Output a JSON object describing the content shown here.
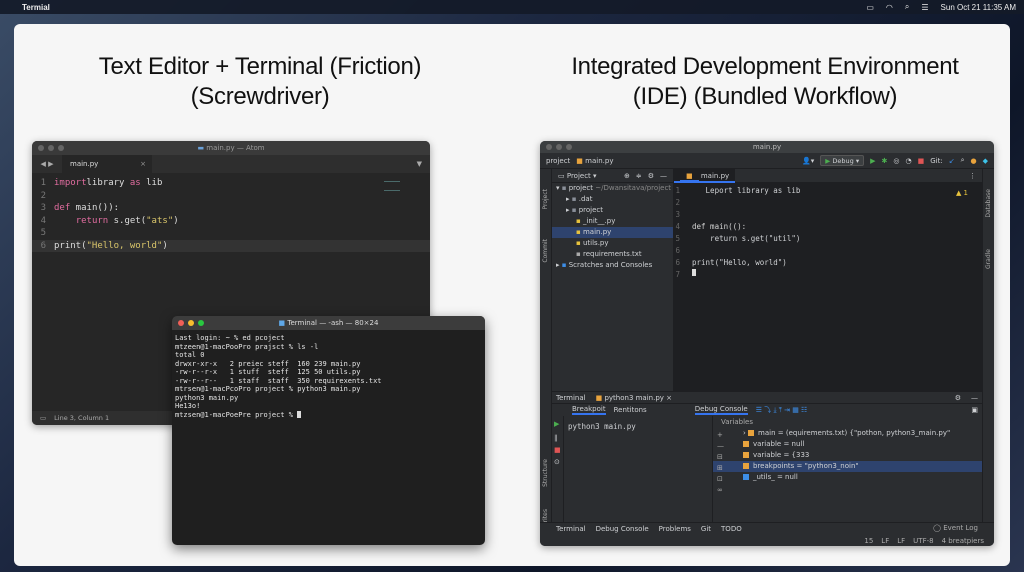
{
  "menubar": {
    "app_name": "Termial",
    "datetime": "Sun Oct 21 11:35 AM"
  },
  "left": {
    "heading_line1": "Text Editor + Terminal (Friction)",
    "heading_line2": "(Screwdriver)",
    "editor": {
      "window_title": "main.py — Atom",
      "tab": "main.py",
      "lines": [
        {
          "n": "1",
          "parts": [
            [
              "kw",
              "import"
            ],
            [
              "",
              "library "
            ],
            [
              "kw",
              "as"
            ],
            [
              "",
              " lib"
            ]
          ]
        },
        {
          "n": "2",
          "parts": []
        },
        {
          "n": "3",
          "parts": [
            [
              "kw",
              "def"
            ],
            [
              "",
              " main()):"
            ]
          ]
        },
        {
          "n": "4",
          "parts": [
            [
              "",
              "    "
            ],
            [
              "kw",
              "return"
            ],
            [
              "",
              " s.get("
            ],
            [
              "str",
              "\"ats\""
            ],
            [
              "",
              ")"
            ]
          ]
        },
        {
          "n": "5",
          "parts": []
        },
        {
          "n": "6",
          "parts": [
            [
              "",
              "print("
            ],
            [
              "str",
              "\"Hello, world\""
            ],
            [
              "",
              ")"
            ]
          ],
          "current": true
        }
      ],
      "status": "Line 3, Column 1"
    },
    "terminal": {
      "window_title": "Terminal — -ash — 80×24",
      "lines": [
        "Last login: ~ % ed pcoject",
        "mtzeen@1-macPooPro prajsct % ls -l",
        "total 0",
        "drwxr-xr-x   2 preiec steff  160 239 main.py",
        "-rw-r--r-x   1 stuff  steff  125 50 utils.py",
        "-rw-r--r--   1 staff  staff  350 requirexents.txt",
        "mtrsen@1-macPcoPro project % python3 main.py",
        "python3 main.py",
        "He13o!",
        "mtzsen@1-macPoePre project % "
      ]
    }
  },
  "right": {
    "heading_line1": "Integrated Development Environment",
    "heading_line2_bold": "(IDE)",
    "heading_line2_light": " (Bundled Workflow)",
    "ide": {
      "window_title": "main.py",
      "toolbar_project": "project",
      "toolbar_file": "main.py",
      "run_config": "Debug",
      "git_label": "Git:",
      "project_header": "Project",
      "tree": [
        {
          "label": "project",
          "extra": " ~/Dwansitava/project",
          "indent": 0,
          "icon": "folder"
        },
        {
          "label": ".dat",
          "indent": 1,
          "icon": "folder"
        },
        {
          "label": "project",
          "indent": 1,
          "icon": "folder"
        },
        {
          "label": "_init__.py",
          "indent": 2,
          "icon": "py"
        },
        {
          "label": "main.py",
          "indent": 2,
          "icon": "py",
          "selected": true
        },
        {
          "label": "utils.py",
          "indent": 2,
          "icon": "py"
        },
        {
          "label": "requirements.txt",
          "indent": 2,
          "icon": "txt"
        },
        {
          "label": "Scratches and Consoles",
          "indent": 0,
          "icon": "scratch"
        }
      ],
      "editor_tab": "main.py",
      "code": [
        {
          "n": "1",
          "text": "   Leport library as lib",
          "kwlen": 0
        },
        {
          "n": "2",
          "text": ""
        },
        {
          "n": "3",
          "text": ""
        },
        {
          "n": "4",
          "text": "def main(():"
        },
        {
          "n": "5",
          "text": "    return s.get(\"util\")"
        },
        {
          "n": "6",
          "text": ""
        },
        {
          "n": "6",
          "text": "print(\"Hello, world\")"
        },
        {
          "n": "7",
          "text": ""
        }
      ],
      "warning": "▲ 1",
      "bottom_tabs": {
        "terminal": "Terminal",
        "run": "python3 main.py"
      },
      "sub_tabs": {
        "breakpoints": "Breakpoit",
        "renditions": "Rentitons",
        "debug_console": "Debug Console"
      },
      "run_output": "python3 main.py",
      "variables_header": "Variables",
      "variables": [
        {
          "text": "main = (equirements.txt) {\"pothon, python3_main.py\"",
          "color": "#e8a33d"
        },
        {
          "text": "variable = null",
          "color": "#e8a33d"
        },
        {
          "text": "variable = {333",
          "color": "#e8a33d"
        },
        {
          "text": "breakpoints = \"python3_noin\"",
          "color": "#e8a33d",
          "selected": true
        },
        {
          "text": "_utils_ = null",
          "color": "#3d8ee8"
        }
      ],
      "status_tabs": [
        "Terminal",
        "Debug Console",
        "Problems",
        "Git",
        "TODO"
      ],
      "event_log": "Event Log",
      "status_info": [
        "15",
        "LF",
        "LF",
        "UTF-8",
        "4 breatpiers"
      ]
    }
  }
}
